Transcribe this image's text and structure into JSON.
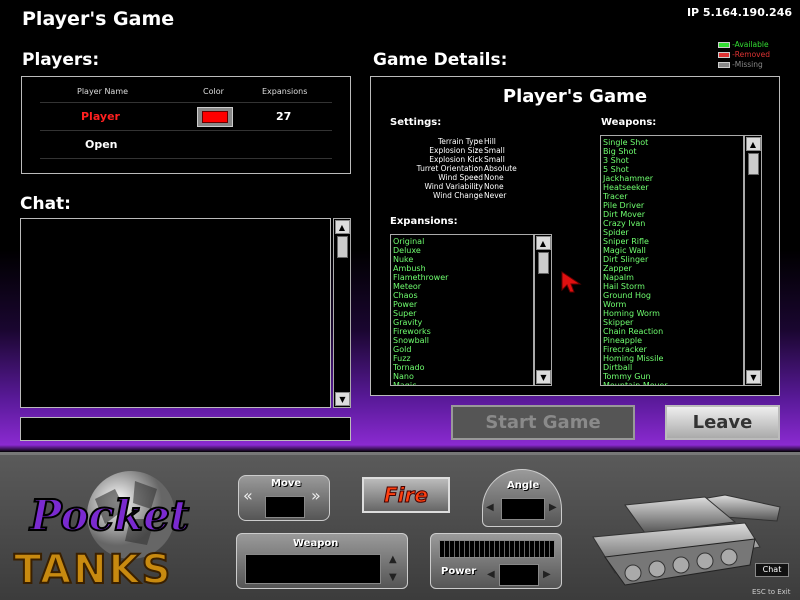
{
  "header": {
    "title": "Player's Game",
    "ip": "IP 5.164.190.246"
  },
  "legend": [
    {
      "label": "-Available",
      "color": "#33dd33"
    },
    {
      "label": "-Removed",
      "color": "#dd3333"
    },
    {
      "label": "-Missing",
      "color": "#888888"
    }
  ],
  "players": {
    "label": "Players:",
    "columns": [
      "Player Name",
      "Color",
      "Expansions"
    ],
    "rows": [
      {
        "name": "Player",
        "name_color": "#ff2020",
        "color": "#ff0000",
        "expansions": "27"
      },
      {
        "name": "Open"
      }
    ]
  },
  "chat": {
    "label": "Chat:",
    "input_value": ""
  },
  "game_details": {
    "label": "Game Details:",
    "game_name": "Player's Game",
    "settings_label": "Settings:",
    "settings": [
      {
        "key": "Terrain Type",
        "value": "Hill"
      },
      {
        "key": "Explosion Size",
        "value": "Small"
      },
      {
        "key": "Explosion Kick",
        "value": "Small"
      },
      {
        "key": "Turret Orientation",
        "value": "Absolute"
      },
      {
        "key": "Wind Speed",
        "value": "None"
      },
      {
        "key": "Wind Variability",
        "value": "None"
      },
      {
        "key": "Wind Change",
        "value": "Never"
      }
    ],
    "expansions_label": "Expansions:",
    "expansions": [
      "Original",
      "Deluxe",
      "Nuke",
      "Ambush",
      "Flamethrower",
      "Meteor",
      "Chaos",
      "Power",
      "Super",
      "Gravity",
      "Fireworks",
      "Snowball",
      "Gold",
      "Fuzz",
      "Tornado",
      "Nano",
      "Magic"
    ],
    "weapons_label": "Weapons:",
    "weapons": [
      "Single Shot",
      "Big Shot",
      "3 Shot",
      "5 Shot",
      "Jackhammer",
      "Heatseeker",
      "Tracer",
      "Pile Driver",
      "Dirt Mover",
      "Crazy Ivan",
      "Spider",
      "Sniper Rifle",
      "Magic Wall",
      "Dirt Slinger",
      "Zapper",
      "Napalm",
      "Hail Storm",
      "Ground Hog",
      "Worm",
      "Homing Worm",
      "Skipper",
      "Chain Reaction",
      "Pineapple",
      "Firecracker",
      "Homing Missile",
      "Dirtball",
      "Tommy Gun",
      "Mountain Mover"
    ]
  },
  "buttons": {
    "start": "Start Game",
    "leave": "Leave"
  },
  "controls": {
    "move": "Move",
    "fire": "Fire",
    "angle": "Angle",
    "weapon": "Weapon",
    "power": "Power",
    "logo_top": "Pocket",
    "logo_bottom": "TANKS",
    "chat": "Chat",
    "esc": "ESC to Exit"
  }
}
